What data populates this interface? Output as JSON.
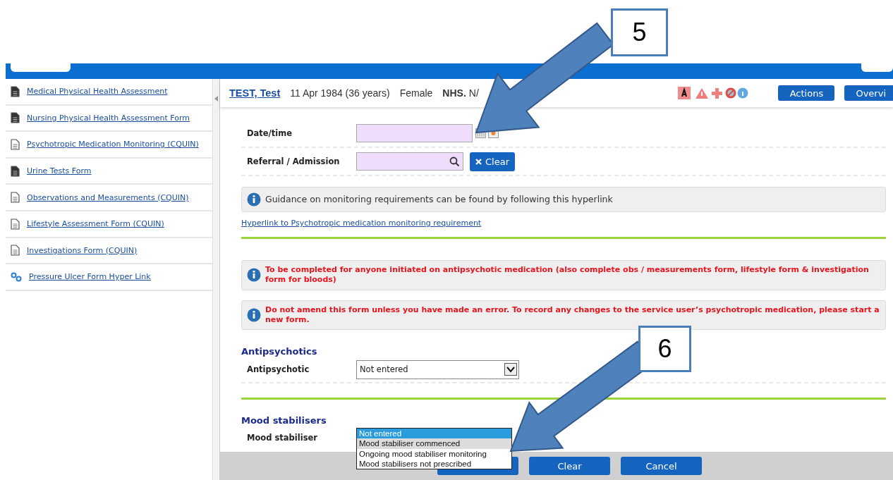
{
  "annotations": [
    {
      "label": "5"
    },
    {
      "label": "6"
    }
  ],
  "sidebar": {
    "items": [
      {
        "label": "Medical Physical Health Assessment",
        "kind": "filled"
      },
      {
        "label": "Nursing Physical Health Assessment Form",
        "kind": "filled"
      },
      {
        "label": "Psychotropic Medication Monitoring (CQUIN)",
        "kind": "outline"
      },
      {
        "label": "Urine Tests Form",
        "kind": "filled"
      },
      {
        "label": "Observations and Measurements (CQUIN)",
        "kind": "outline"
      },
      {
        "label": "Lifestyle Assessment Form (CQUIN)",
        "kind": "outline"
      },
      {
        "label": "Investigations Form (CQUIN)",
        "kind": "outline"
      },
      {
        "label": "Pressure Ulcer Form Hyper Link",
        "kind": "link"
      }
    ]
  },
  "patient_bar": {
    "name": "TEST, Test",
    "dob": "11 Apr 1984 (36 years)",
    "gender": "Female",
    "nhs_label": "NHS.",
    "nhs_value": "N/",
    "buttons": [
      "Actions",
      "Overvi"
    ]
  },
  "form": {
    "fields": [
      {
        "label": "Date/time",
        "kind": "date"
      },
      {
        "label": "Referral / Admission",
        "kind": "lookup",
        "button": "Clear"
      }
    ],
    "guidance": "Guidance on monitoring requirements can be found by following this hyperlink",
    "hyperlink": "Hyperlink to Psychotropic medication monitoring requirement",
    "notices": [
      "To be completed for anyone initiated on antipsychotic medication (also complete obs / measurements form, lifestyle form & investigation form for bloods)",
      "Do not amend this form unless you have made an error. To record any changes to the service user’s psychotropic medication, please start a new form."
    ],
    "sections": [
      {
        "title": "Antipsychotics",
        "field": {
          "label": "Antipsychotic",
          "open": false,
          "value": "Not entered"
        }
      },
      {
        "title": "Mood stabilisers",
        "field": {
          "label": "Mood stabiliser",
          "open": true,
          "options": [
            {
              "label": "Not entered",
              "selected": true,
              "hovered": false
            },
            {
              "label": "Mood stabiliser commenced",
              "selected": false,
              "hovered": true
            },
            {
              "label": "Ongoing mood stabiliser monitoring",
              "selected": false,
              "hovered": false
            },
            {
              "label": "Mood stabilisers not prescribed",
              "selected": false,
              "hovered": false
            }
          ]
        }
      }
    ]
  },
  "footer": {
    "buttons": [
      "Clear",
      "Cancel"
    ]
  }
}
